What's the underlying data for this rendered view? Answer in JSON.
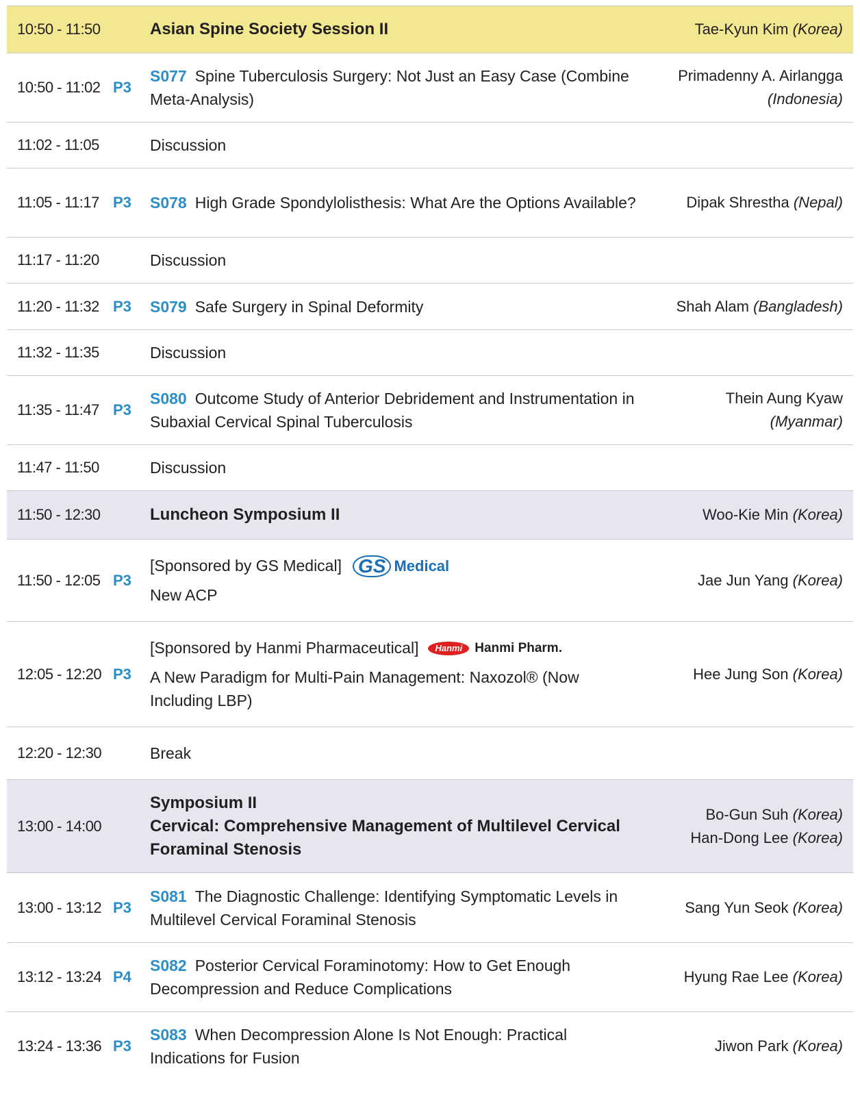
{
  "rows": [
    {
      "time": "10:50 - 11:50",
      "title": "Asian Spine Society Session II",
      "speaker": "Tae-Kyun Kim",
      "country": "(Korea)"
    },
    {
      "time": "10:50 - 11:02",
      "room": "P3",
      "code": "S077",
      "title": "Spine Tuberculosis Surgery: Not Just an Easy Case (Combine Meta-Analysis)",
      "speaker": "Primadenny A. Airlangga",
      "country": "(Indonesia)"
    },
    {
      "time": "11:02 - 11:05",
      "title": "Discussion"
    },
    {
      "time": "11:05 - 11:17",
      "room": "P3",
      "code": "S078",
      "title": "High Grade Spondylolisthesis: What Are the Options Available?",
      "speaker": "Dipak Shrestha",
      "country": "(Nepal)"
    },
    {
      "time": "11:17 - 11:20",
      "title": "Discussion"
    },
    {
      "time": "11:20 - 11:32",
      "room": "P3",
      "code": "S079",
      "title": "Safe Surgery in Spinal Deformity",
      "speaker": "Shah Alam",
      "country": "(Bangladesh)"
    },
    {
      "time": "11:32 - 11:35",
      "title": "Discussion"
    },
    {
      "time": "11:35 - 11:47",
      "room": "P3",
      "code": "S080",
      "title": "Outcome Study of Anterior Debridement and Instrumentation in Subaxial Cervical Spinal Tuberculosis",
      "speaker": "Thein Aung Kyaw",
      "country": "(Myanmar)"
    },
    {
      "time": "11:47 - 11:50",
      "title": "Discussion"
    },
    {
      "time": "11:50 - 12:30",
      "title": "Luncheon Symposium II",
      "speaker": "Woo-Kie Min",
      "country": "(Korea)"
    },
    {
      "time": "11:50 - 12:05",
      "room": "P3",
      "sponsor": "[Sponsored by GS Medical]",
      "logo_gs": "GS",
      "logo_gs_text": "Medical",
      "title": "New ACP",
      "speaker": "Jae Jun Yang",
      "country": "(Korea)"
    },
    {
      "time": "12:05 - 12:20",
      "room": "P3",
      "sponsor": "[Sponsored by Hanmi Pharmaceutical]",
      "logo_hanmi": "Hanmi",
      "logo_hanmi_text": "Hanmi Pharm.",
      "title": "A New Paradigm for Multi-Pain Management: Naxozol® (Now Including LBP)",
      "speaker": "Hee Jung Son",
      "country": "(Korea)"
    },
    {
      "time": "12:20 - 12:30",
      "title": "Break"
    },
    {
      "time": "13:00 - 14:00",
      "title": "Symposium II",
      "title2": "Cervical: Comprehensive Management of Multilevel Cervical Foraminal Stenosis",
      "speaker": "Bo-Gun Suh",
      "country": "(Korea)",
      "speaker2": "Han-Dong Lee",
      "country2": "(Korea)"
    },
    {
      "time": "13:00 - 13:12",
      "room": "P3",
      "code": "S081",
      "title": "The Diagnostic Challenge: Identifying Symptomatic Levels in Multilevel Cervical Foraminal Stenosis",
      "speaker": "Sang Yun Seok",
      "country": "(Korea)"
    },
    {
      "time": "13:12 - 13:24",
      "room": "P4",
      "code": "S082",
      "title": "Posterior Cervical Foraminotomy: How to Get Enough Decompression and Reduce Complications",
      "speaker": "Hyung Rae Lee",
      "country": "(Korea)"
    },
    {
      "time": "13:24 - 13:36",
      "room": "P3",
      "code": "S083",
      "title": "When Decompression Alone Is Not Enough: Practical Indications for Fusion",
      "speaker": "Jiwon Park",
      "country": "(Korea)"
    }
  ],
  "colors": {
    "session_yellow": "#f2e891",
    "session_lavender": "#e6e6f0",
    "accent_blue": "#2a8ec8"
  }
}
